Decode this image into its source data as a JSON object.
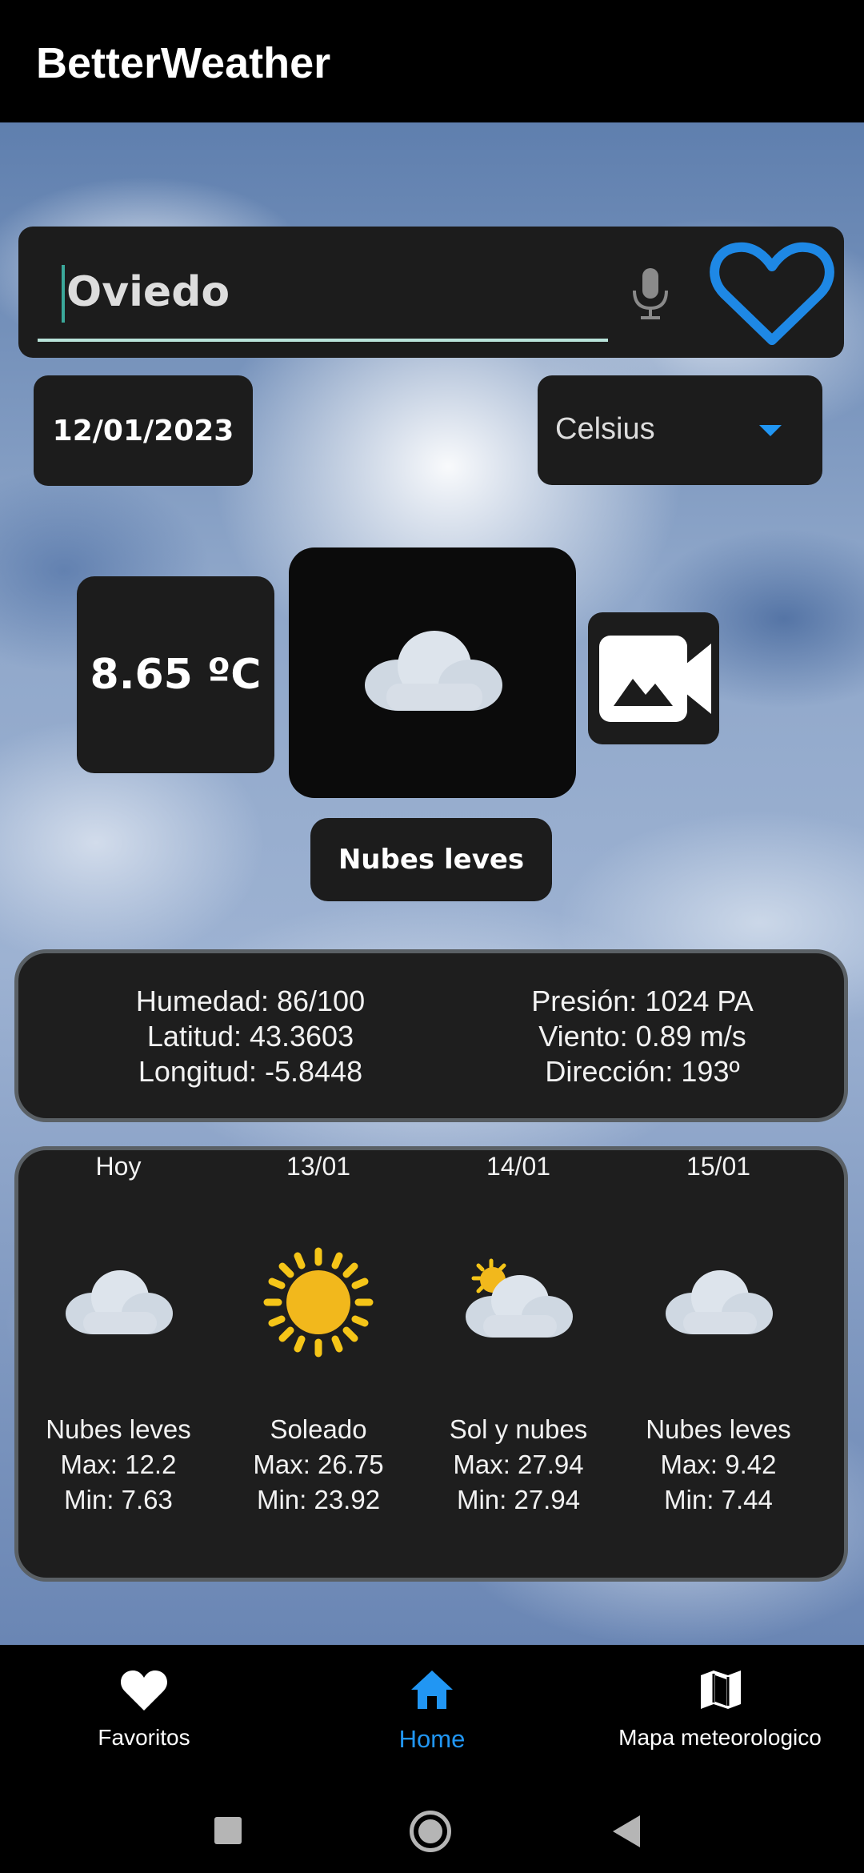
{
  "app": {
    "title": "BetterWeather"
  },
  "search": {
    "value": "Oviedo",
    "mic_icon": "microphone-icon",
    "favorite_icon": "heart-outline-icon",
    "favorite_color": "#1e88e5"
  },
  "date": "12/01/2023",
  "unit_selector": {
    "selected": "Celsius",
    "accent": "#2196f3"
  },
  "current": {
    "temperature": "8.65 ºC",
    "icon": "cloud-icon",
    "description": "Nubes leves",
    "camera_icon": "video-camera-icon"
  },
  "details": {
    "humidity": "Humedad: 86/100",
    "latitude": "Latitud: 43.3603",
    "longitude": "Longitud: -5.8448",
    "pressure": "Presión: 1024 PA",
    "wind": "Viento: 0.89 m/s",
    "direction": "Dirección: 193º"
  },
  "forecast": [
    {
      "day": "Hoy",
      "icon": "cloud-icon",
      "desc": "Nubes leves",
      "max": "Max: 12.2",
      "min": "Min: 7.63"
    },
    {
      "day": "13/01",
      "icon": "sun-icon",
      "desc": "Soleado",
      "max": "Max: 26.75",
      "min": "Min: 23.92"
    },
    {
      "day": "14/01",
      "icon": "sun-cloud-icon",
      "desc": "Sol y nubes",
      "max": "Max: 27.94",
      "min": "Min: 27.94"
    },
    {
      "day": "15/01",
      "icon": "cloud-icon",
      "desc": "Nubes leves",
      "max": "Max: 9.42",
      "min": "Min: 7.44"
    }
  ],
  "nav": {
    "favorites": "Favoritos",
    "home": "Home",
    "map": "Mapa meteorologico",
    "active_color": "#2196f3"
  }
}
